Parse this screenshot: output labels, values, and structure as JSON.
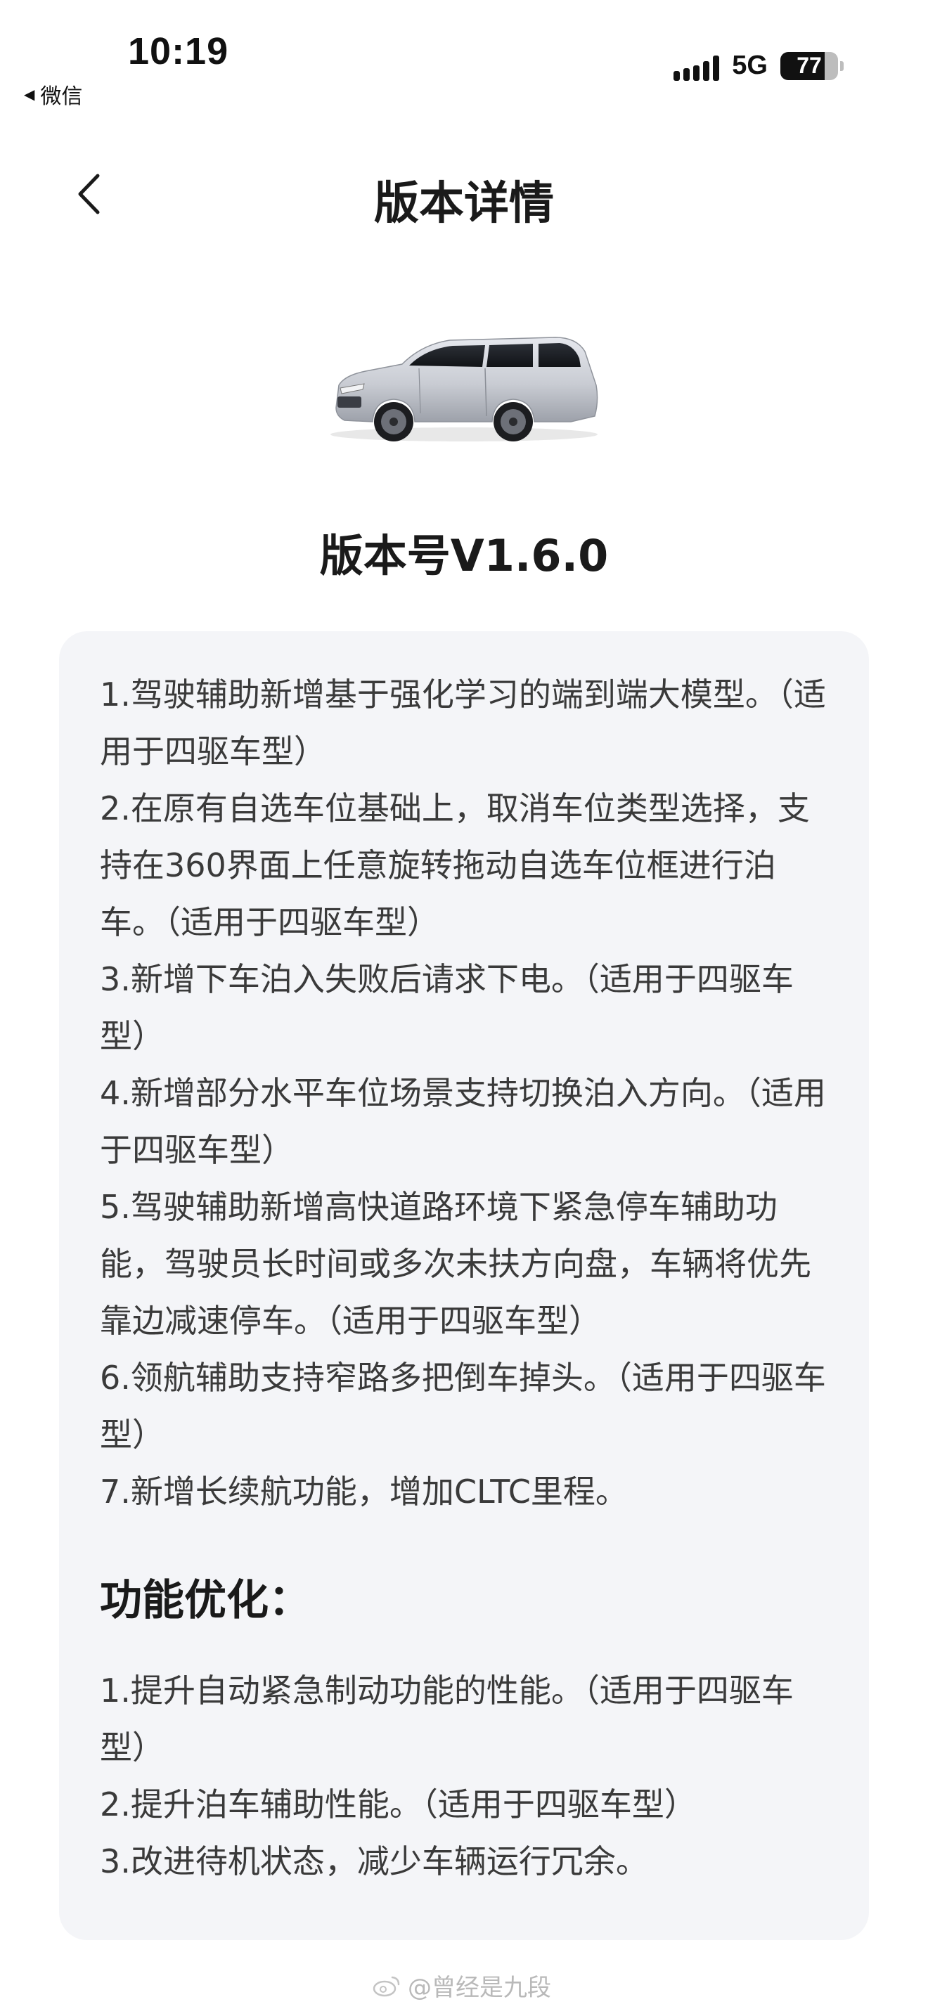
{
  "status_bar": {
    "time": "10:19",
    "back_app_label": "微信",
    "network": "5G",
    "battery_level": 77,
    "battery_text": "77"
  },
  "nav": {
    "title": "版本详情",
    "back_icon": "chevron-left-icon"
  },
  "hero": {
    "car_image": "car-image",
    "version_label": "版本号V1.6.0"
  },
  "release_notes": {
    "new_features": [
      "1.驾驶辅助新增基于强化学习的端到端大模型。（适用于四驱车型）",
      "2.在原有自选车位基础上，取消车位类型选择，支持在360界面上任意旋转拖动自选车位框进行泊车。（适用于四驱车型）",
      "3.新增下车泊入失败后请求下电。（适用于四驱车型）",
      "4.新增部分水平车位场景支持切换泊入方向。（适用于四驱车型）",
      "5.驾驶辅助新增高快道路环境下紧急停车辅助功能，驾驶员长时间或多次未扶方向盘，车辆将优先靠边减速停车。（适用于四驱车型）",
      "6.领航辅助支持窄路多把倒车掉头。（适用于四驱车型）",
      "7.新增长续航功能，增加CLTC里程。"
    ],
    "optimization_heading": "功能优化：",
    "optimizations": [
      "1.提升自动紧急制动功能的性能。（适用于四驱车型）",
      "2.提升泊车辅助性能。（适用于四驱车型）",
      "3.改进待机状态，减少车辆运行冗余。"
    ]
  },
  "watermark": {
    "text": "@曾经是九段"
  }
}
